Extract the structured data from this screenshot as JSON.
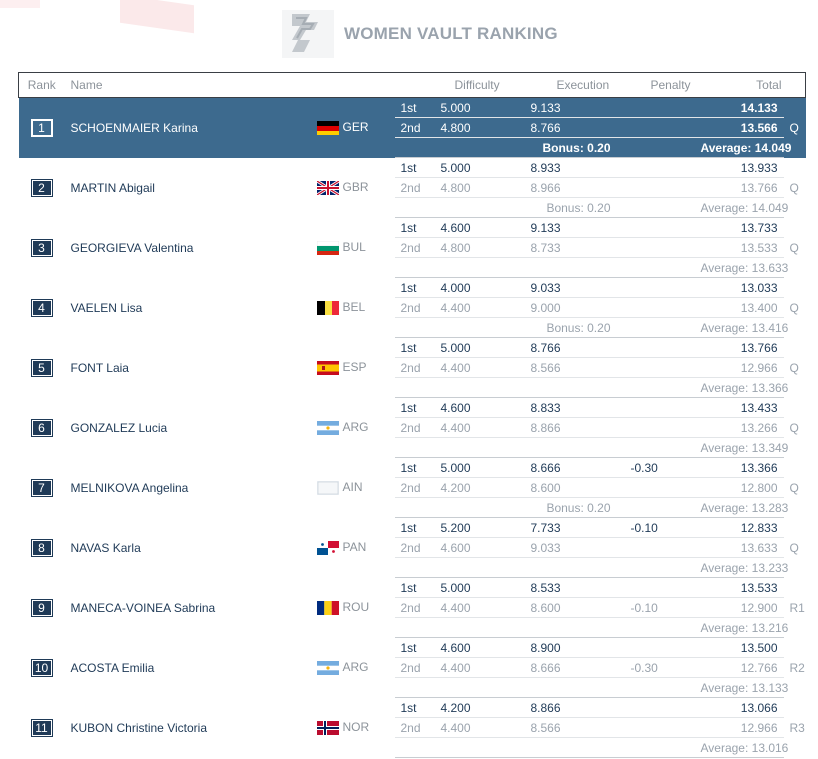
{
  "page": {
    "title": "WOMEN VAULT RANKING"
  },
  "columns": {
    "rank": "Rank",
    "name": "Name",
    "difficulty": "Difficulty",
    "execution": "Execution",
    "penalty": "Penalty",
    "total": "Total"
  },
  "rows": [
    {
      "rank": "1",
      "name": "SCHOENMAIER Karina",
      "nat": "GER",
      "flag": "ger",
      "v1": {
        "att": "1st",
        "d": "5.000",
        "e": "9.133",
        "p": "",
        "t": "14.133"
      },
      "v2": {
        "att": "2nd",
        "d": "4.800",
        "e": "8.766",
        "p": "",
        "t": "13.566"
      },
      "bonus": "Bonus: 0.20",
      "avg": "Average: 14.049",
      "q": "Q",
      "selected": true
    },
    {
      "rank": "2",
      "name": "MARTIN Abigail",
      "nat": "GBR",
      "flag": "gbr",
      "v1": {
        "att": "1st",
        "d": "5.000",
        "e": "8.933",
        "p": "",
        "t": "13.933"
      },
      "v2": {
        "att": "2nd",
        "d": "4.800",
        "e": "8.966",
        "p": "",
        "t": "13.766"
      },
      "bonus": "Bonus: 0.20",
      "avg": "Average: 14.049",
      "q": "Q"
    },
    {
      "rank": "3",
      "name": "GEORGIEVA Valentina",
      "nat": "BUL",
      "flag": "bul",
      "v1": {
        "att": "1st",
        "d": "4.600",
        "e": "9.133",
        "p": "",
        "t": "13.733"
      },
      "v2": {
        "att": "2nd",
        "d": "4.800",
        "e": "8.733",
        "p": "",
        "t": "13.533"
      },
      "bonus": "",
      "avg": "Average: 13.633",
      "q": "Q"
    },
    {
      "rank": "4",
      "name": "VAELEN Lisa",
      "nat": "BEL",
      "flag": "bel",
      "v1": {
        "att": "1st",
        "d": "4.000",
        "e": "9.033",
        "p": "",
        "t": "13.033"
      },
      "v2": {
        "att": "2nd",
        "d": "4.400",
        "e": "9.000",
        "p": "",
        "t": "13.400"
      },
      "bonus": "Bonus: 0.20",
      "avg": "Average: 13.416",
      "q": "Q"
    },
    {
      "rank": "5",
      "name": "FONT Laia",
      "nat": "ESP",
      "flag": "esp",
      "v1": {
        "att": "1st",
        "d": "5.000",
        "e": "8.766",
        "p": "",
        "t": "13.766"
      },
      "v2": {
        "att": "2nd",
        "d": "4.400",
        "e": "8.566",
        "p": "",
        "t": "12.966"
      },
      "bonus": "",
      "avg": "Average: 13.366",
      "q": "Q"
    },
    {
      "rank": "6",
      "name": "GONZALEZ Lucia",
      "nat": "ARG",
      "flag": "arg",
      "v1": {
        "att": "1st",
        "d": "4.600",
        "e": "8.833",
        "p": "",
        "t": "13.433"
      },
      "v2": {
        "att": "2nd",
        "d": "4.400",
        "e": "8.866",
        "p": "",
        "t": "13.266"
      },
      "bonus": "",
      "avg": "Average: 13.349",
      "q": "Q"
    },
    {
      "rank": "7",
      "name": "MELNIKOVA Angelina",
      "nat": "AIN",
      "flag": "ain",
      "v1": {
        "att": "1st",
        "d": "5.000",
        "e": "8.666",
        "p": "-0.30",
        "t": "13.366"
      },
      "v2": {
        "att": "2nd",
        "d": "4.200",
        "e": "8.600",
        "p": "",
        "t": "12.800"
      },
      "bonus": "Bonus: 0.20",
      "avg": "Average: 13.283",
      "q": "Q"
    },
    {
      "rank": "8",
      "name": "NAVAS Karla",
      "nat": "PAN",
      "flag": "pan",
      "v1": {
        "att": "1st",
        "d": "5.200",
        "e": "7.733",
        "p": "-0.10",
        "t": "12.833"
      },
      "v2": {
        "att": "2nd",
        "d": "4.600",
        "e": "9.033",
        "p": "",
        "t": "13.633"
      },
      "bonus": "",
      "avg": "Average: 13.233",
      "q": "Q"
    },
    {
      "rank": "9",
      "name": "MANECA-VOINEA Sabrina",
      "nat": "ROU",
      "flag": "rou",
      "v1": {
        "att": "1st",
        "d": "5.000",
        "e": "8.533",
        "p": "",
        "t": "13.533"
      },
      "v2": {
        "att": "2nd",
        "d": "4.400",
        "e": "8.600",
        "p": "-0.10",
        "t": "12.900"
      },
      "bonus": "",
      "avg": "Average: 13.216",
      "q": "R1"
    },
    {
      "rank": "10",
      "name": "ACOSTA Emilia",
      "nat": "ARG",
      "flag": "arg",
      "v1": {
        "att": "1st",
        "d": "4.600",
        "e": "8.900",
        "p": "",
        "t": "13.500"
      },
      "v2": {
        "att": "2nd",
        "d": "4.400",
        "e": "8.666",
        "p": "-0.30",
        "t": "12.766"
      },
      "bonus": "",
      "avg": "Average: 13.133",
      "q": "R2"
    },
    {
      "rank": "11",
      "name": "KUBON Christine Victoria",
      "nat": "NOR",
      "flag": "nor",
      "v1": {
        "att": "1st",
        "d": "4.200",
        "e": "8.866",
        "p": "",
        "t": "13.066"
      },
      "v2": {
        "att": "2nd",
        "d": "4.400",
        "e": "8.566",
        "p": "",
        "t": "12.966"
      },
      "bonus": "",
      "avg": "Average: 13.016",
      "q": "R3"
    }
  ]
}
